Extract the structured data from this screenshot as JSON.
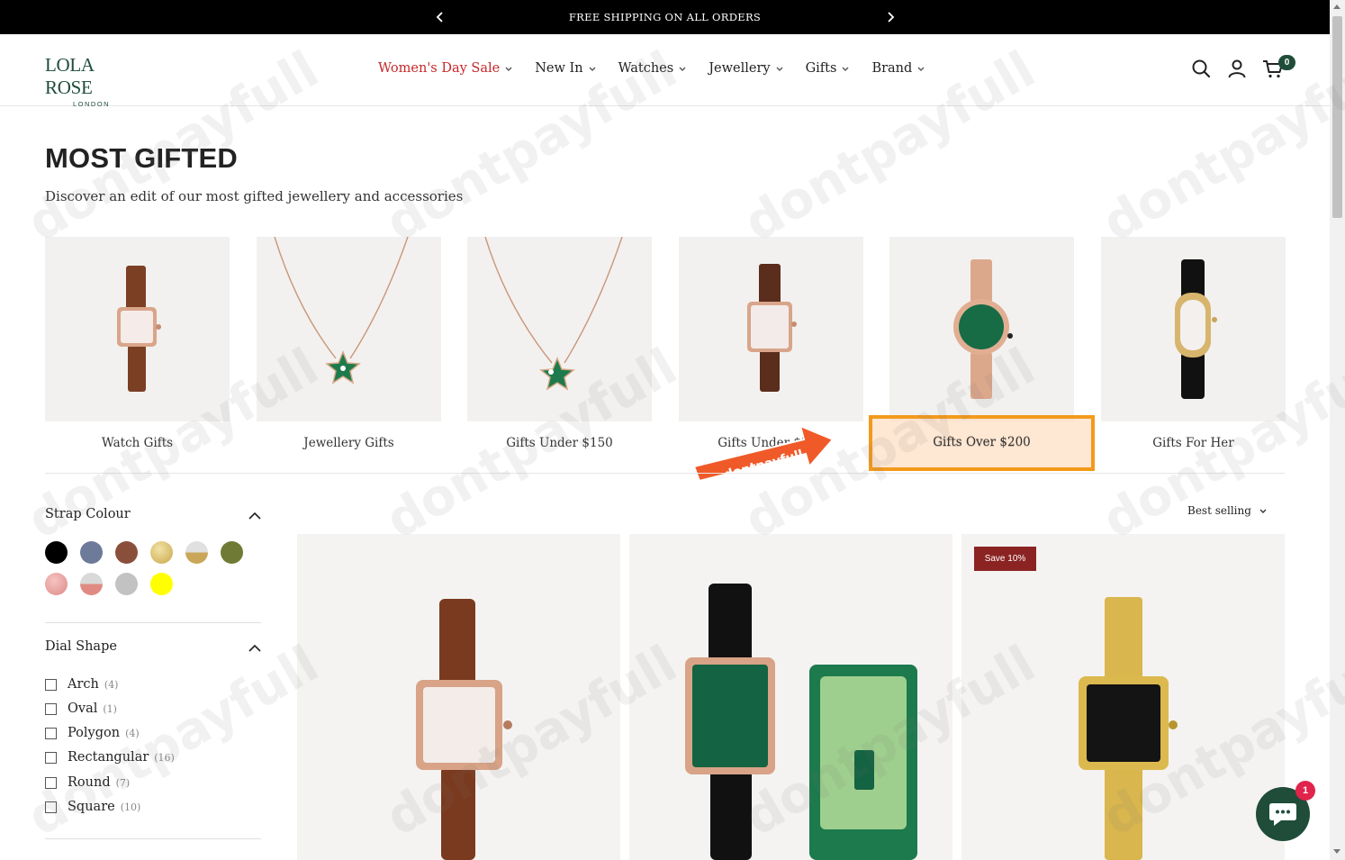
{
  "announcement": {
    "text": "FREE SHIPPING ON ALL ORDERS"
  },
  "brand": {
    "name": "LOLA ROSE",
    "sub": "LONDON"
  },
  "nav": [
    {
      "label": "Women's Day Sale"
    },
    {
      "label": "New In"
    },
    {
      "label": "Watches"
    },
    {
      "label": "Jewellery"
    },
    {
      "label": "Gifts"
    },
    {
      "label": "Brand"
    }
  ],
  "cart": {
    "count": "0"
  },
  "page": {
    "title": "MOST GIFTED",
    "subtitle": "Discover an edit of our most gifted jewellery and accessories"
  },
  "categories": [
    {
      "label": "Watch Gifts"
    },
    {
      "label": "Jewellery Gifts"
    },
    {
      "label": "Gifts Under $150"
    },
    {
      "label": "Gifts Under $200"
    },
    {
      "label": "Gifts Over $200"
    },
    {
      "label": "Gifts For Her"
    }
  ],
  "promo": {
    "text": "dontpayfull"
  },
  "filters": {
    "strap_colour": {
      "title": "Strap Colour",
      "swatches": [
        "#000000",
        "#6d7a99",
        "#8a4f3a",
        "#d8c177",
        "#b8b8b8",
        "#6f7a35",
        "#e69a98",
        "#c9c9c9",
        "#bdbdbd",
        "#ffff00"
      ]
    },
    "dial_shape": {
      "title": "Dial Shape",
      "options": [
        {
          "name": "Arch",
          "count": "(4)"
        },
        {
          "name": "Oval",
          "count": "(1)"
        },
        {
          "name": "Polygon",
          "count": "(4)"
        },
        {
          "name": "Rectangular",
          "count": "(16)"
        },
        {
          "name": "Round",
          "count": "(7)"
        },
        {
          "name": "Square",
          "count": "(10)"
        }
      ]
    }
  },
  "sort": {
    "label": "Best selling"
  },
  "products": [
    {
      "badge": ""
    },
    {
      "badge": ""
    },
    {
      "badge": "Save 10%"
    }
  ],
  "chat": {
    "unread": "1"
  },
  "watermark": "dontpayfull"
}
